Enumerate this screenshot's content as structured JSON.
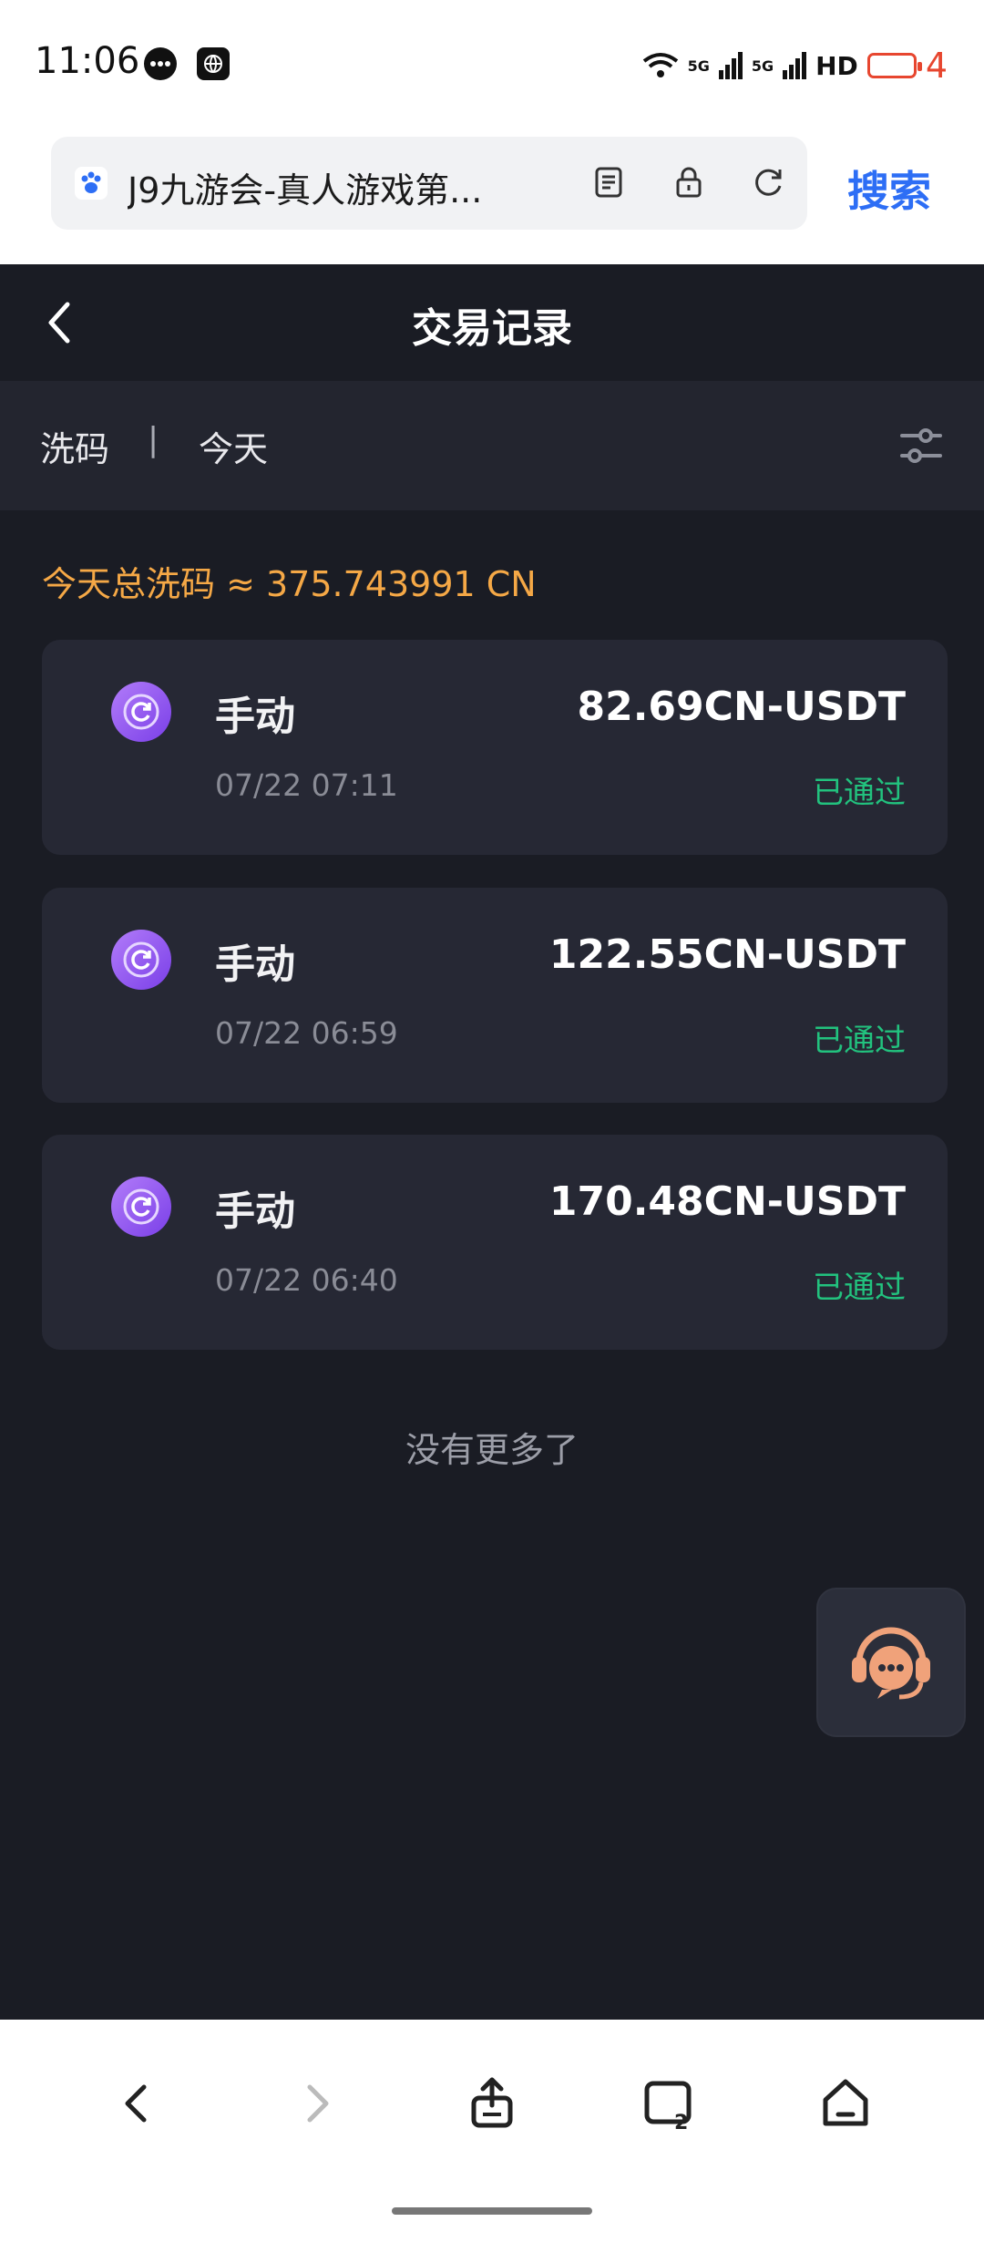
{
  "status_bar": {
    "time": "11:06",
    "network_1": "5G",
    "network_2": "5G",
    "hd": "HD",
    "battery_level": "4"
  },
  "browser": {
    "url_title": "J9九游会-真人游戏第...",
    "search_label": "搜索"
  },
  "header": {
    "title": "交易记录"
  },
  "filter": {
    "type": "洗码",
    "separator": "|",
    "date": "今天"
  },
  "summary": {
    "text": "今天总洗码 ≈ 375.743991 CN"
  },
  "records": [
    {
      "type": "手动",
      "time": "07/22 07:11",
      "amount": "82.69CN-USDT",
      "status": "已通过"
    },
    {
      "type": "手动",
      "time": "07/22 06:59",
      "amount": "122.55CN-USDT",
      "status": "已通过"
    },
    {
      "type": "手动",
      "time": "07/22 06:40",
      "amount": "170.48CN-USDT",
      "status": "已通过"
    }
  ],
  "footer_text": "没有更多了",
  "colors": {
    "accent_orange": "#f5a846",
    "status_green": "#22c27e",
    "search_blue": "#2d6ef5",
    "record_icon_purple": "#8a4ef0"
  },
  "icons": {
    "back": "chevron-left-icon",
    "filter": "sliders-icon",
    "record": "refresh-coin-icon",
    "service": "customer-service-headset-icon"
  }
}
